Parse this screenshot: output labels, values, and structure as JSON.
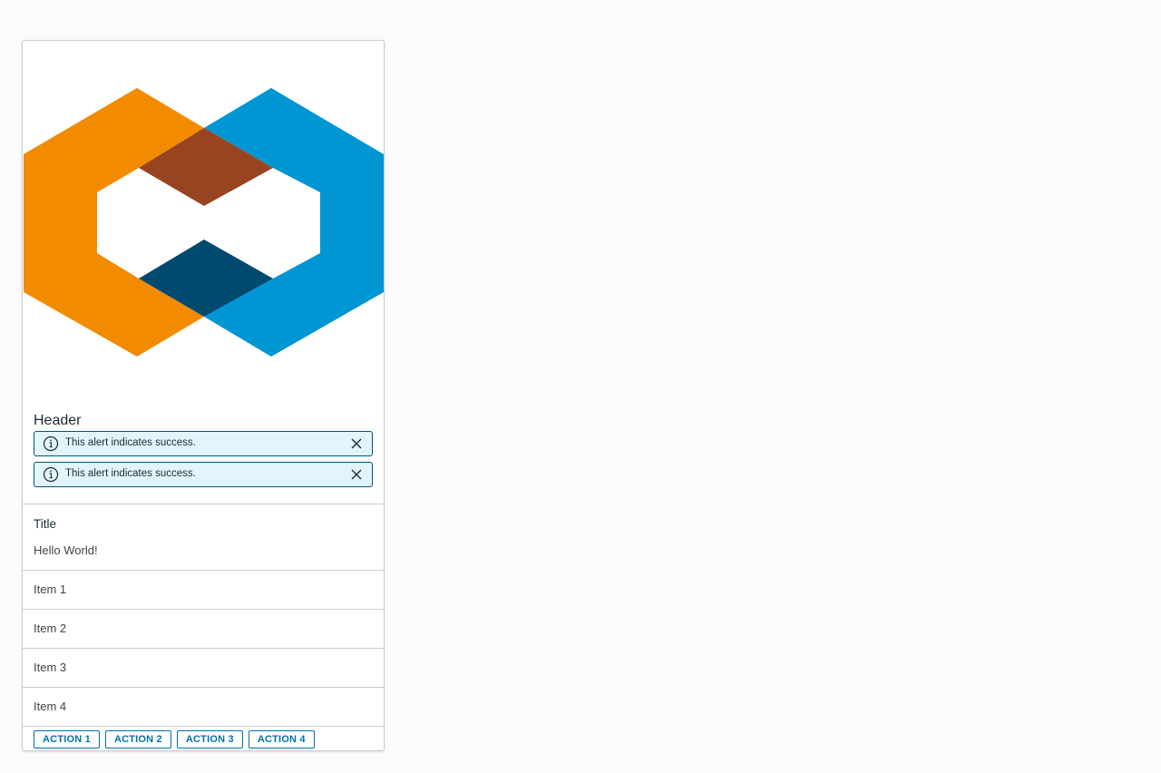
{
  "card": {
    "media": {
      "icon": "hexagon-logo-icon",
      "colors": {
        "orange": "#f28b00",
        "blue": "#0095d3",
        "dark_orange": "#984420",
        "dark_blue": "#004a70"
      }
    },
    "header": "Header",
    "alerts": [
      {
        "text": "This alert indicates success.",
        "icon": "info-circle-icon",
        "close_icon": "close-icon"
      },
      {
        "text": "This alert indicates success.",
        "icon": "info-circle-icon",
        "close_icon": "close-icon"
      }
    ],
    "block": {
      "title": "Title",
      "text": "Hello World!"
    },
    "list": [
      {
        "label": "Item 1"
      },
      {
        "label": "Item 2"
      },
      {
        "label": "Item 3"
      },
      {
        "label": "Item 4"
      }
    ],
    "actions": [
      {
        "label": "ACTION 1"
      },
      {
        "label": "ACTION 2"
      },
      {
        "label": "ACTION 3"
      },
      {
        "label": "ACTION 4"
      }
    ]
  },
  "colors": {
    "accent": "#0072a3",
    "alert_bg": "#e3f5fc",
    "alert_border": "#00567a"
  }
}
